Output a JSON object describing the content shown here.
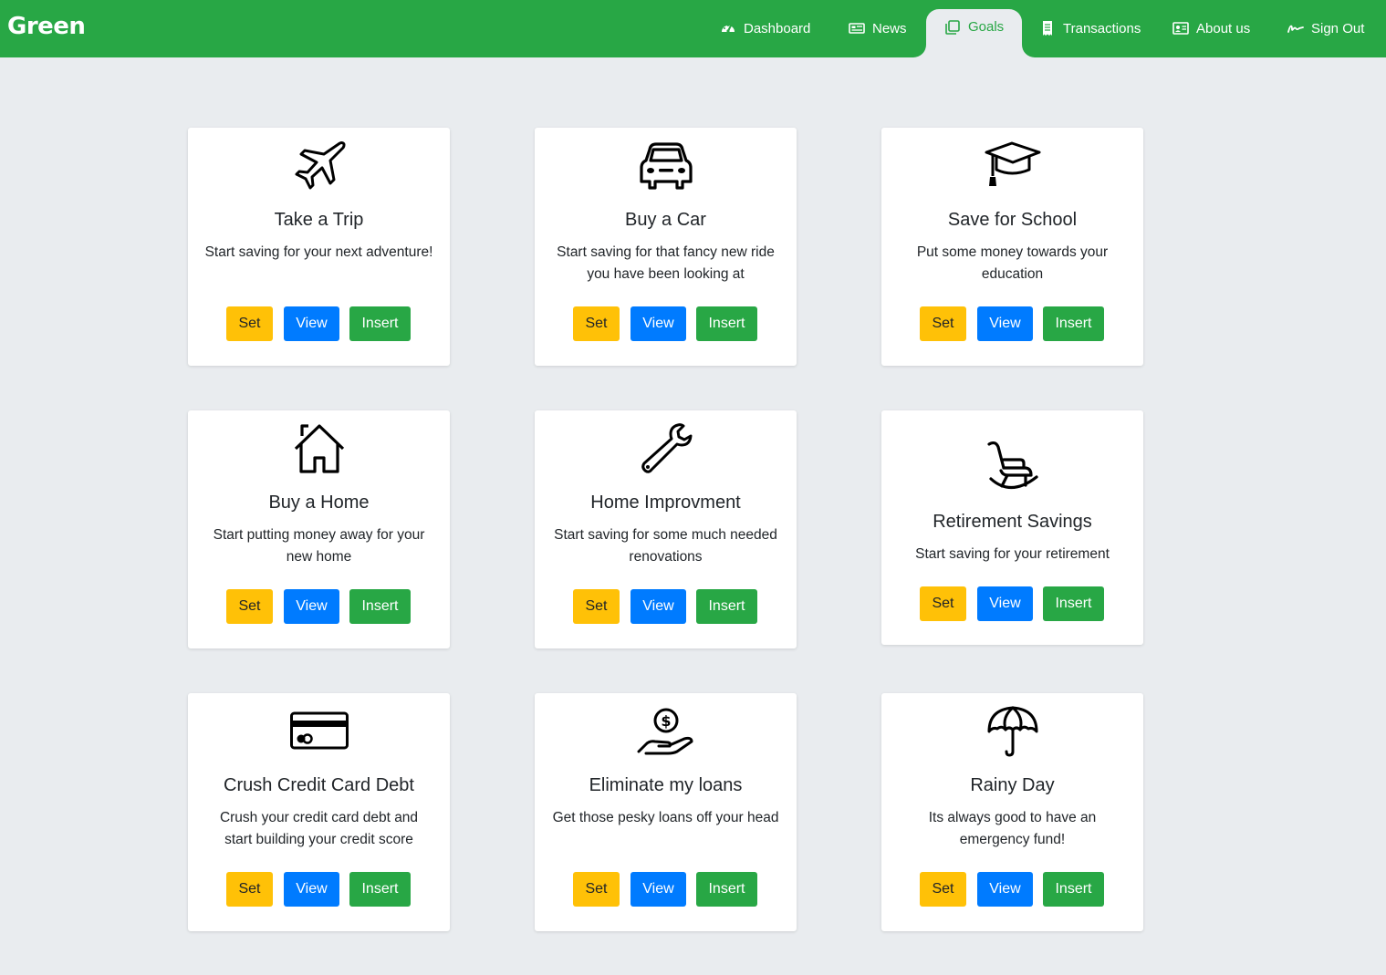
{
  "brand": "Green",
  "nav": [
    {
      "label": "Dashboard",
      "icon": "gauge-icon"
    },
    {
      "label": "News",
      "icon": "newspaper-icon"
    },
    {
      "label": "Goals",
      "icon": "layers-icon",
      "active": true
    },
    {
      "label": "Transactions",
      "icon": "receipt-icon"
    },
    {
      "label": "About us",
      "icon": "contact-card-icon"
    },
    {
      "label": "Sign Out",
      "icon": "signature-icon"
    }
  ],
  "buttons": {
    "set": "Set",
    "view": "View",
    "insert": "Insert"
  },
  "cards": [
    {
      "title": "Take a Trip",
      "text": "Start saving for your next adventure!",
      "icon": "airplane-icon"
    },
    {
      "title": "Buy a Car",
      "text": "Start saving for that fancy new ride you have been looking at",
      "icon": "car-icon"
    },
    {
      "title": "Save for School",
      "text": "Put some money towards your education",
      "icon": "graduation-cap-icon"
    },
    {
      "title": "Buy a Home",
      "text": "Start putting money away for your new home",
      "icon": "house-icon"
    },
    {
      "title": "Home Improvment",
      "text": "Start saving for some much needed renovations",
      "icon": "wrench-icon"
    },
    {
      "title": "Retirement Savings",
      "text": "Start saving for your retirement",
      "icon": "rocking-chair-icon"
    },
    {
      "title": "Crush Credit Card Debt",
      "text": "Crush your credit card debt and start building your credit score",
      "icon": "credit-card-icon"
    },
    {
      "title": "Eliminate my loans",
      "text": "Get those pesky loans off your head",
      "icon": "hand-coin-icon"
    },
    {
      "title": "Rainy Day",
      "text": "Its always good to have an emergency fund!",
      "icon": "umbrella-icon"
    }
  ],
  "colors": {
    "navbar": "#28a745",
    "background": "#e9ecef",
    "set": "#ffc107",
    "view": "#007bff",
    "insert": "#28a745"
  }
}
